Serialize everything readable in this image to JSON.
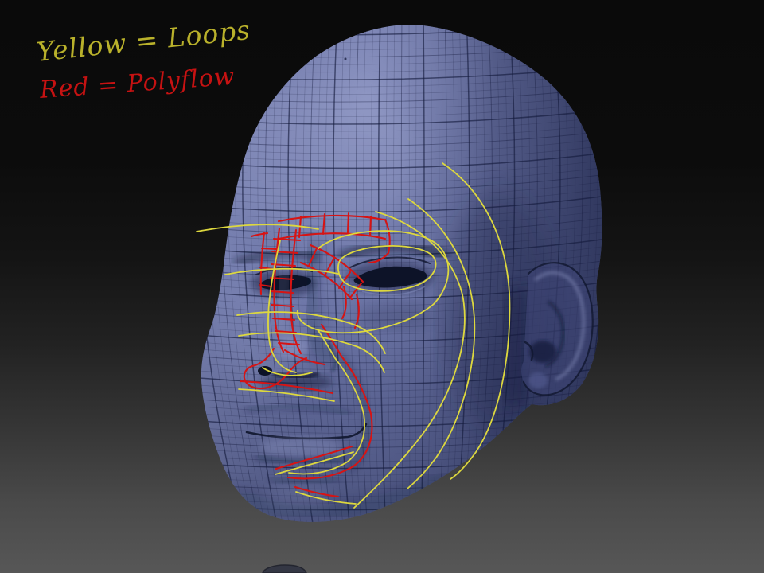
{
  "legend": {
    "items": [
      {
        "label": "Yellow = Loops",
        "color": "#b9b12b"
      },
      {
        "label": "Red = Polyflow",
        "color": "#c61212"
      }
    ]
  },
  "annotations": {
    "loop_color": "#ddd83e",
    "polyflow_color": "#d61414"
  },
  "canvas": {
    "background_top": "#0a0a0a",
    "background_bottom": "#575757",
    "mesh_base_color": "#6b74a6",
    "mesh_highlight_color": "#99a1cc",
    "mesh_shadow_color": "#272e52",
    "wireframe_color": "#131a3c"
  }
}
